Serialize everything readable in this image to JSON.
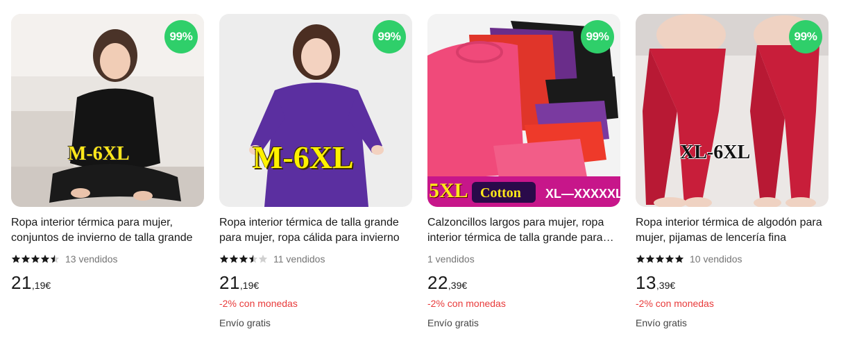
{
  "products": [
    {
      "badge": "99%",
      "size_tag": "M-6XL",
      "title": "Ropa interior térmica para mujer, conjuntos de invierno de talla grande",
      "rating": 4.5,
      "sold": "13 vendidos",
      "price_int": "21",
      "price_dec": ",19€",
      "promo": "",
      "shipping": "",
      "image_colors": {
        "bg": "#e8e4e0",
        "garment": "#141414"
      }
    },
    {
      "badge": "99%",
      "size_tag": "M-6XL",
      "title": "Ropa interior térmica de talla grande para mujer, ropa cálida para invierno",
      "rating": 3.5,
      "sold": "11 vendidos",
      "price_int": "21",
      "price_dec": ",19€",
      "promo": "-2% con monedas",
      "shipping": "Envío gratis",
      "image_colors": {
        "bg": "#ececec",
        "garment": "#5b2fa0"
      }
    },
    {
      "badge": "99%",
      "size_tag": "5XL",
      "cotton_label": "Cotton",
      "range_label": "XL—XXXXXL",
      "title": "Calzoncillos largos para mujer, ropa interior térmica de talla grande para invierno",
      "rating": 0,
      "sold": "1 vendidos",
      "price_int": "22",
      "price_dec": ",39€",
      "promo": "-2% con monedas",
      "shipping": "Envío gratis",
      "image_colors": {
        "bg": "#f2f2f2",
        "garment": "#f04a7a"
      }
    },
    {
      "badge": "99%",
      "size_tag": "XL-6XL",
      "title": "Ropa interior térmica de algodón para mujer, pijamas de lencería fina",
      "rating": 5,
      "sold": "10 vendidos",
      "price_int": "13",
      "price_dec": ",39€",
      "promo": "-2% con monedas",
      "shipping": "Envío gratis",
      "image_colors": {
        "bg": "#eae6e4",
        "garment": "#c81e3a"
      }
    }
  ],
  "colors": {
    "badge": "#2fcf6a",
    "promo": "#e83a3a",
    "star": "#191919"
  }
}
